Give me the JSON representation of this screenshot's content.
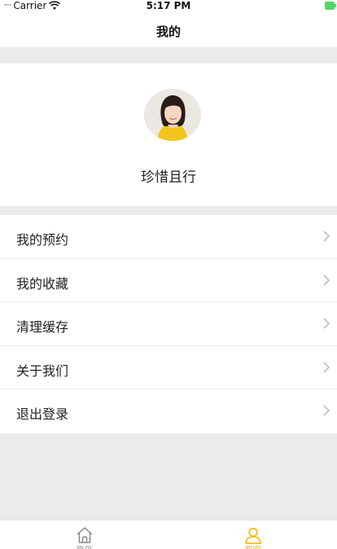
{
  "status_bar": {
    "signal": "·····",
    "carrier": "Carrier",
    "time": "5:17 PM"
  },
  "nav": {
    "title": "我的"
  },
  "profile": {
    "username": "珍惜且行"
  },
  "menu": {
    "items": [
      {
        "label": "我的预约"
      },
      {
        "label": "我的收藏"
      },
      {
        "label": "清理缓存"
      },
      {
        "label": "关于我们"
      },
      {
        "label": "退出登录"
      }
    ]
  },
  "tabbar": {
    "accent_color": "#f5b400",
    "inactive_color": "#888888",
    "tabs": [
      {
        "label": "首页",
        "icon": "home-icon",
        "active": false
      },
      {
        "label": "我的",
        "icon": "user-icon",
        "active": true
      }
    ]
  }
}
